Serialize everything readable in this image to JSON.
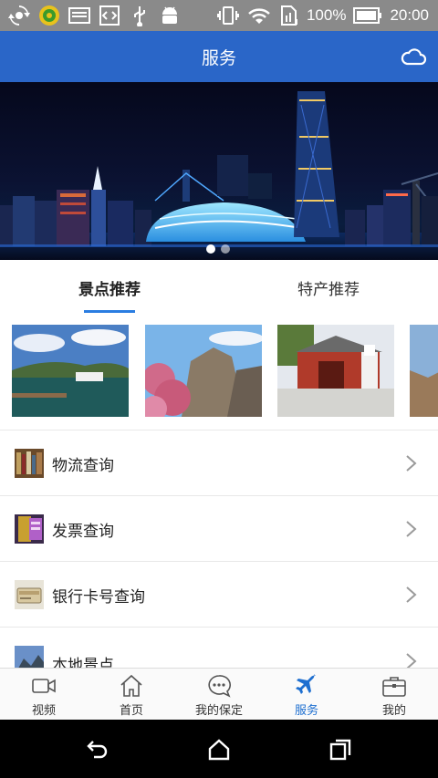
{
  "status_bar": {
    "battery_text": "100%",
    "time": "20:00"
  },
  "header": {
    "title": "服务",
    "cloud_icon": "cloud-icon"
  },
  "banner": {
    "slide_count": 2,
    "active_slide": 1
  },
  "tabs": [
    {
      "label": "景点推荐",
      "active": true
    },
    {
      "label": "特产推荐",
      "active": false
    }
  ],
  "list": [
    {
      "label": "物流查询",
      "icon": "books-shelf-icon"
    },
    {
      "label": "发票查询",
      "icon": "invoice-icon"
    },
    {
      "label": "银行卡号查询",
      "icon": "wallet-icon"
    },
    {
      "label": "本地景点",
      "icon": "landscape-icon"
    }
  ],
  "bottom_nav": [
    {
      "label": "视频",
      "icon": "video-camera-icon",
      "active": false
    },
    {
      "label": "首页",
      "icon": "home-icon",
      "active": false
    },
    {
      "label": "我的保定",
      "icon": "chat-bubble-icon",
      "active": false
    },
    {
      "label": "服务",
      "icon": "airplane-icon",
      "active": true
    },
    {
      "label": "我的",
      "icon": "briefcase-icon",
      "active": false
    }
  ],
  "colors": {
    "header_bg": "#2a66c8",
    "accent": "#2a7de1",
    "active_nav": "#1e6fd0",
    "status_bar_bg": "#8a8a8a"
  }
}
